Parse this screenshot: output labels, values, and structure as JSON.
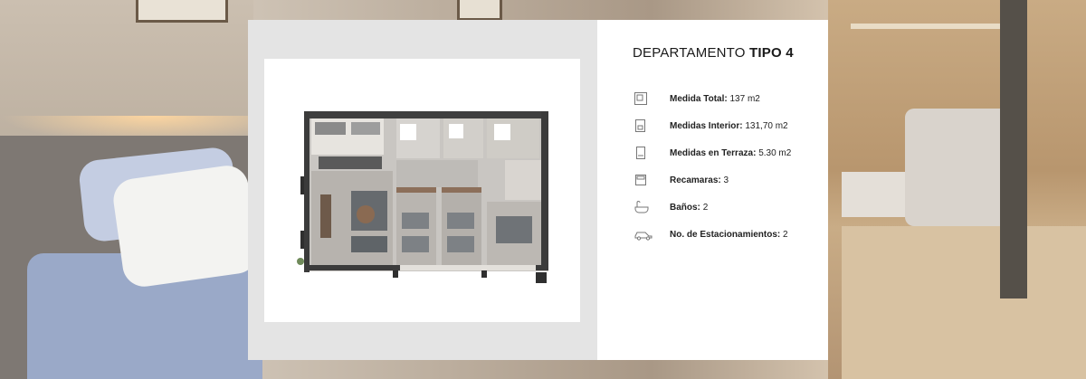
{
  "card": {
    "title_prefix": "DEPARTAMENTO",
    "title_bold": "TIPO 4"
  },
  "specs": [
    {
      "icon": "total-area-icon",
      "label": "Medida Total:",
      "value": "137 m2"
    },
    {
      "icon": "interior-area-icon",
      "label": "Medidas Interior:",
      "value": "131,70 m2"
    },
    {
      "icon": "terrace-icon",
      "label": "Medidas en Terraza:",
      "value": "5.30 m2"
    },
    {
      "icon": "bed-icon",
      "label": "Recamaras:",
      "value": "3"
    },
    {
      "icon": "bathtub-icon",
      "label": "Baños:",
      "value": "2"
    },
    {
      "icon": "car-icon",
      "label": "No. de Estacionamientos:",
      "value": "2"
    }
  ],
  "colors": {
    "card_left_bg": "#e4e4e4",
    "card_right_bg": "#ffffff",
    "text": "#1a1a1a"
  }
}
